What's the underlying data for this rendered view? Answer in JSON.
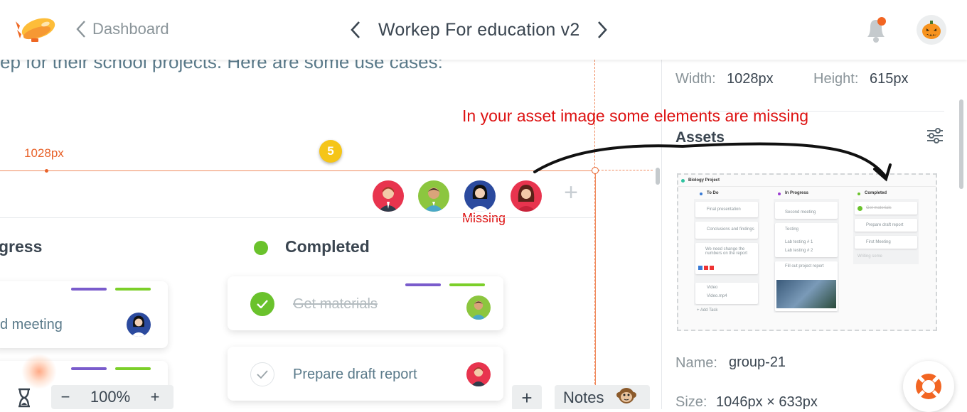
{
  "header": {
    "back_label": "Dashboard",
    "title": "Workep For education v2",
    "colors": {
      "accent_orange": "#f7931e",
      "notification_dot": "#f26522"
    }
  },
  "canvas": {
    "intro_text": "ep for their school projects. Here are some use cases:",
    "width_label": "1028px",
    "badge_count": "5",
    "missing_label": "Missing",
    "columns": [
      {
        "title": "gress"
      },
      {
        "title": "Completed"
      }
    ],
    "in_progress_cards": [
      {
        "text": "d meeting"
      },
      {
        "text": ""
      }
    ],
    "completed_cards": [
      {
        "text": "Get materials",
        "done": true
      },
      {
        "text": "Prepare draft report",
        "done": false
      }
    ],
    "toolbar": {
      "zoom_minus": "−",
      "zoom_value": "100%",
      "zoom_plus": "+",
      "add_label": "+",
      "notes_label": "Notes"
    }
  },
  "annotation": {
    "text": "In your asset image some elements are missing"
  },
  "panel": {
    "width_label": "Width:",
    "width_value": "1028px",
    "height_label": "Height:",
    "height_value": "615px",
    "assets_title": "Assets",
    "name_label": "Name:",
    "name_value": "group-21",
    "size_label": "Size:",
    "size_value": "1046px × 633px"
  },
  "asset_preview": {
    "project_title": "Biology Project",
    "columns": [
      "To Do",
      "In Progress",
      "Completed"
    ],
    "todo_items": [
      "Final presentation",
      "Conclusions and findings",
      "We need change the numbers on the report",
      "Video",
      "Video.mp4",
      "+ Add Task"
    ],
    "progress_items": [
      "Second meeting",
      "Testing",
      "Lab testing # 1",
      "Lab testing # 2",
      "Fill out project report"
    ],
    "completed_items": [
      "Get materials",
      "Prepare draft report",
      "First Meeting",
      "Writing some"
    ]
  }
}
